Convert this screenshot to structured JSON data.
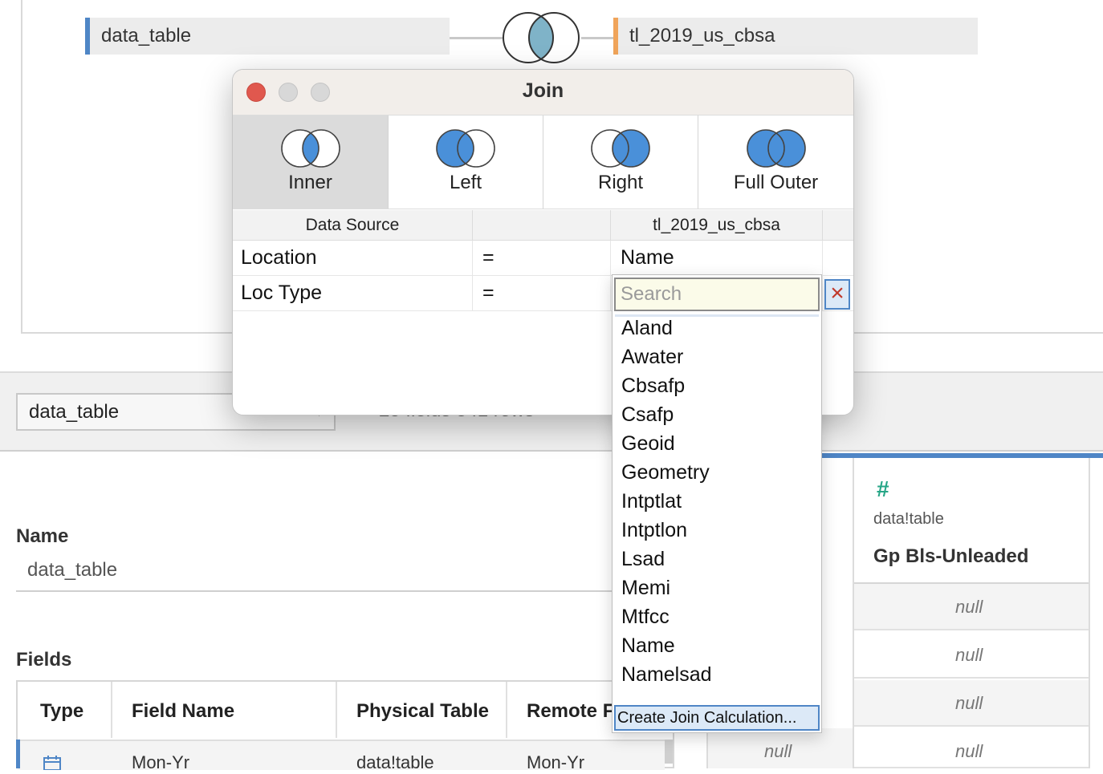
{
  "canvas": {
    "left_table": "data_table",
    "right_table": "tl_2019_us_cbsa"
  },
  "lower": {
    "datasource_select": "data_table",
    "field_count": "25 fields 341 rows",
    "name_label": "Name",
    "name_value": "data_table",
    "fields_label": "Fields",
    "fields_headers": [
      "Type",
      "Field Name",
      "Physical Table",
      "Remote F"
    ],
    "fields_row": {
      "field_name": "Mon-Yr",
      "physical_table": "data!table",
      "remote": "Mon-Yr"
    },
    "preview": {
      "col_source": "data!table",
      "col_name": "Gp Bls-Unleaded",
      "cells": [
        "null",
        "null",
        "null",
        "null"
      ],
      "left_cell": "null"
    }
  },
  "dialog": {
    "title": "Join",
    "join_types": [
      {
        "label": "Inner",
        "selected": true
      },
      {
        "label": "Left",
        "selected": false
      },
      {
        "label": "Right",
        "selected": false
      },
      {
        "label": "Full Outer",
        "selected": false
      }
    ],
    "clause_header": {
      "left": "Data Source",
      "op": "",
      "right": "tl_2019_us_cbsa"
    },
    "clauses": [
      {
        "left": "Location",
        "op": "=",
        "right": "Name"
      },
      {
        "left": "Loc Type",
        "op": "=",
        "right": ""
      }
    ]
  },
  "dropdown": {
    "search_placeholder": "Search",
    "options": [
      "Aland",
      "Awater",
      "Cbsafp",
      "Csafp",
      "Geoid",
      "Geometry",
      "Intptlat",
      "Intptlon",
      "Lsad",
      "Memi",
      "Mtfcc",
      "Name",
      "Namelsad"
    ],
    "calc_option": "Create Join Calculation..."
  },
  "colors": {
    "venn_fill": "#4a90d9",
    "venn_inner_canvas": "#7fb3c8",
    "left_accent": "#4f86c6",
    "right_accent": "#f0a45a",
    "close_red": "#e0584e"
  }
}
